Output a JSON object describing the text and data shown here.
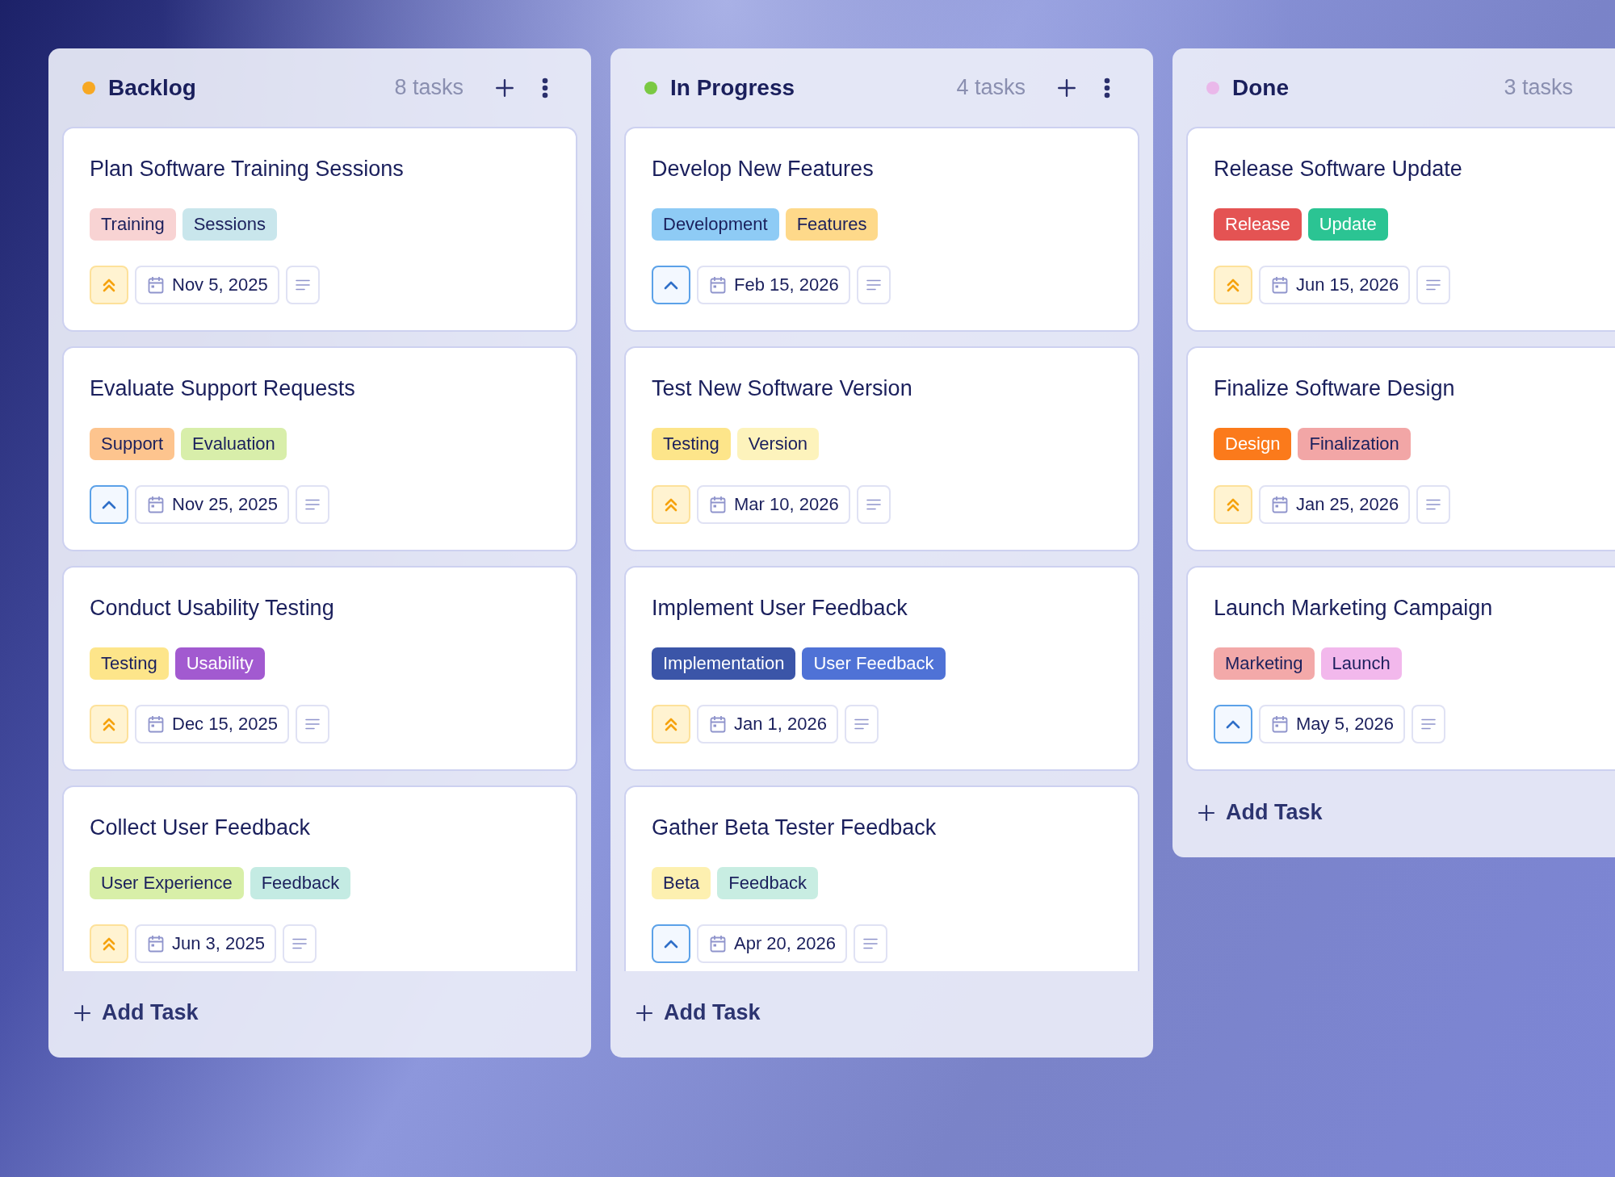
{
  "columns": [
    {
      "title": "Backlog",
      "color": "#f7a823",
      "count": "8 tasks",
      "actions": true,
      "add_label": "Add Task",
      "cards": [
        {
          "title": "Plan Software Training Sessions",
          "tags": [
            {
              "label": "Training",
              "color": "#f8d3d3"
            },
            {
              "label": "Sessions",
              "color": "#c9e6ec"
            }
          ],
          "kind": "high",
          "date": "Nov 5, 2025"
        },
        {
          "title": "Evaluate Support Requests",
          "tags": [
            {
              "label": "Support",
              "color": "#fdc48e"
            },
            {
              "label": "Evaluation",
              "color": "#d8eeaa"
            }
          ],
          "kind": "medium",
          "date": "Nov 25, 2025"
        },
        {
          "title": "Conduct Usability Testing",
          "tags": [
            {
              "label": "Testing",
              "color": "#fde58a"
            },
            {
              "label": "Usability",
              "color": "#a25ad0"
            }
          ],
          "kind": "high",
          "date": "Dec 15, 2025"
        },
        {
          "title": "Collect User Feedback",
          "tags": [
            {
              "label": "User Experience",
              "color": "#d8efa8"
            },
            {
              "label": "Feedback",
              "color": "#c4ebe3"
            }
          ],
          "kind": "high",
          "date": "Jun 3, 2025"
        }
      ]
    },
    {
      "title": "In Progress",
      "color": "#7ac943",
      "count": "4 tasks",
      "actions": true,
      "add_label": "Add Task",
      "cards": [
        {
          "title": "Develop New Features",
          "tags": [
            {
              "label": "Development",
              "color": "#8ecbf5"
            },
            {
              "label": "Features",
              "color": "#fed98a"
            }
          ],
          "kind": "medium",
          "date": "Feb 15, 2026"
        },
        {
          "title": "Test New Software Version",
          "tags": [
            {
              "label": "Testing",
              "color": "#fde58a"
            },
            {
              "label": "Version",
              "color": "#fdf3bc"
            }
          ],
          "kind": "high",
          "date": "Mar 10, 2026"
        },
        {
          "title": "Implement User Feedback",
          "tags": [
            {
              "label": "Implementation",
              "color": "#3b55a8"
            },
            {
              "label": "User Feedback",
              "color": "#4f72d6"
            }
          ],
          "kind": "high",
          "date": "Jan 1, 2026"
        },
        {
          "title": "Gather Beta Tester Feedback",
          "tags": [
            {
              "label": "Beta",
              "color": "#fdf0b0"
            },
            {
              "label": "Feedback",
              "color": "#c8ede2"
            }
          ],
          "kind": "medium",
          "date": "Apr 20, 2026"
        }
      ]
    },
    {
      "title": "Done",
      "color": "#eab8ea",
      "count": "3 tasks",
      "actions": false,
      "add_label": "Add Task",
      "cards": [
        {
          "title": "Release Software Update",
          "tags": [
            {
              "label": "Release",
              "color": "#e45353"
            },
            {
              "label": "Update",
              "color": "#2bc493"
            }
          ],
          "kind": "high",
          "date": "Jun 15, 2026"
        },
        {
          "title": "Finalize Software Design",
          "tags": [
            {
              "label": "Design",
              "color": "#fb7a1b"
            },
            {
              "label": "Finalization",
              "color": "#f2a6a6"
            }
          ],
          "kind": "high",
          "date": "Jan 25, 2026"
        },
        {
          "title": "Launch Marketing Campaign",
          "tags": [
            {
              "label": "Marketing",
              "color": "#f3a9a9"
            },
            {
              "label": "Launch",
              "color": "#f2b8ec"
            }
          ],
          "kind": "medium",
          "date": "May 5, 2026"
        }
      ]
    }
  ]
}
